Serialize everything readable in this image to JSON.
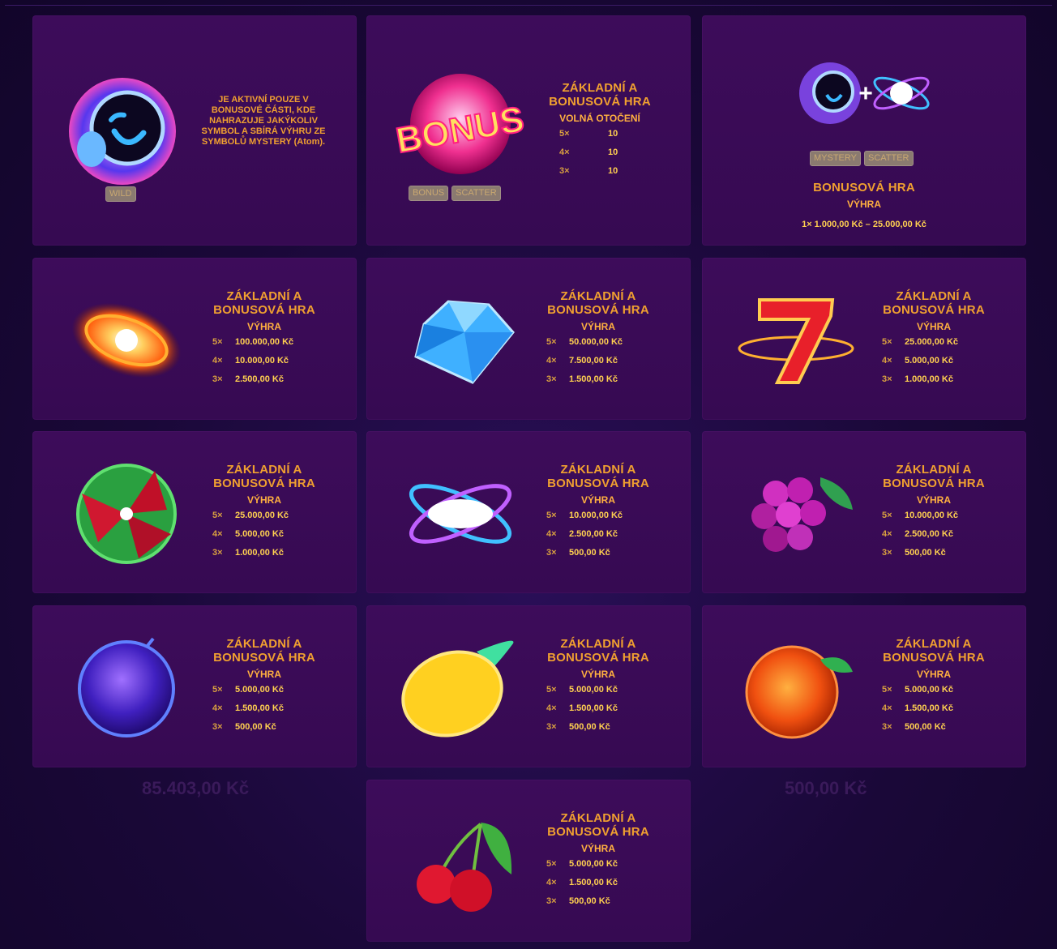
{
  "wild_card": {
    "description": "JE AKTIVNÍ POUZE V BONUSOVÉ ČÁSTI, KDE NAHRAZUJE JAKÝKOLIV SYMBOL A SBÍRÁ VÝHRU ZE SYMBOLŮ MYSTERY (Atom).",
    "tag": "WILD"
  },
  "bonus_card": {
    "title": "ZÁKLADNÍ A BONUSOVÁ HRA",
    "subtitle": "VOLNÁ OTOČENÍ",
    "rows": [
      {
        "mult": "5×",
        "value": "10"
      },
      {
        "mult": "4×",
        "value": "10"
      },
      {
        "mult": "3×",
        "value": "10"
      }
    ],
    "tags": [
      "BONUS",
      "SCATTER"
    ],
    "symbol_text": "BONUS"
  },
  "mystery_card": {
    "title": "BONUSOVÁ HRA",
    "subtitle": "VÝHRA",
    "row": "1× 1.000,00 Kč – 25.000,00 Kč",
    "tags": [
      "MYSTERY",
      "SCATTER"
    ]
  },
  "cards": [
    {
      "title": "ZÁKLADNÍ A BONUSOVÁ HRA",
      "subtitle": "VÝHRA",
      "icon": "galaxy-icon",
      "rows": [
        {
          "mult": "5×",
          "value": "100.000,00 Kč"
        },
        {
          "mult": "4×",
          "value": "10.000,00 Kč"
        },
        {
          "mult": "3×",
          "value": "2.500,00 Kč"
        }
      ]
    },
    {
      "title": "ZÁKLADNÍ A BONUSOVÁ HRA",
      "subtitle": "VÝHRA",
      "icon": "diamond-icon",
      "rows": [
        {
          "mult": "5×",
          "value": "50.000,00 Kč"
        },
        {
          "mult": "4×",
          "value": "7.500,00 Kč"
        },
        {
          "mult": "3×",
          "value": "1.500,00 Kč"
        }
      ]
    },
    {
      "title": "ZÁKLADNÍ A BONUSOVÁ HRA",
      "subtitle": "VÝHRA",
      "icon": "seven-icon",
      "rows": [
        {
          "mult": "5×",
          "value": "25.000,00 Kč"
        },
        {
          "mult": "4×",
          "value": "5.000,00 Kč"
        },
        {
          "mult": "3×",
          "value": "1.000,00 Kč"
        }
      ]
    },
    {
      "title": "ZÁKLADNÍ A BONUSOVÁ HRA",
      "subtitle": "VÝHRA",
      "icon": "watermelon-icon",
      "rows": [
        {
          "mult": "5×",
          "value": "25.000,00 Kč"
        },
        {
          "mult": "4×",
          "value": "5.000,00 Kč"
        },
        {
          "mult": "3×",
          "value": "1.000,00 Kč"
        }
      ]
    },
    {
      "title": "ZÁKLADNÍ A BONUSOVÁ HRA",
      "subtitle": "VÝHRA",
      "icon": "atom-icon",
      "rows": [
        {
          "mult": "5×",
          "value": "10.000,00 Kč"
        },
        {
          "mult": "4×",
          "value": "2.500,00 Kč"
        },
        {
          "mult": "3×",
          "value": "500,00 Kč"
        }
      ]
    },
    {
      "title": "ZÁKLADNÍ A BONUSOVÁ HRA",
      "subtitle": "VÝHRA",
      "icon": "grapes-icon",
      "rows": [
        {
          "mult": "5×",
          "value": "10.000,00 Kč"
        },
        {
          "mult": "4×",
          "value": "2.500,00 Kč"
        },
        {
          "mult": "3×",
          "value": "500,00 Kč"
        }
      ]
    },
    {
      "title": "ZÁKLADNÍ A BONUSOVÁ HRA",
      "subtitle": "VÝHRA",
      "icon": "plum-icon",
      "rows": [
        {
          "mult": "5×",
          "value": "5.000,00 Kč"
        },
        {
          "mult": "4×",
          "value": "1.500,00 Kč"
        },
        {
          "mult": "3×",
          "value": "500,00 Kč"
        }
      ]
    },
    {
      "title": "ZÁKLADNÍ A BONUSOVÁ HRA",
      "subtitle": "VÝHRA",
      "icon": "lemon-icon",
      "rows": [
        {
          "mult": "5×",
          "value": "5.000,00 Kč"
        },
        {
          "mult": "4×",
          "value": "1.500,00 Kč"
        },
        {
          "mult": "3×",
          "value": "500,00 Kč"
        }
      ]
    },
    {
      "title": "ZÁKLADNÍ A BONUSOVÁ HRA",
      "subtitle": "VÝHRA",
      "icon": "orange-icon",
      "rows": [
        {
          "mult": "5×",
          "value": "5.000,00 Kč"
        },
        {
          "mult": "4×",
          "value": "1.500,00 Kč"
        },
        {
          "mult": "3×",
          "value": "500,00 Kč"
        }
      ]
    },
    {
      "title": "ZÁKLADNÍ A BONUSOVÁ HRA",
      "subtitle": "VÝHRA",
      "icon": "cherry-icon",
      "rows": [
        {
          "mult": "5×",
          "value": "5.000,00 Kč"
        },
        {
          "mult": "4×",
          "value": "1.500,00 Kč"
        },
        {
          "mult": "3×",
          "value": "500,00 Kč"
        }
      ]
    }
  ],
  "background_texts": [
    "85.403,00 Kč",
    "500,00 Kč"
  ]
}
